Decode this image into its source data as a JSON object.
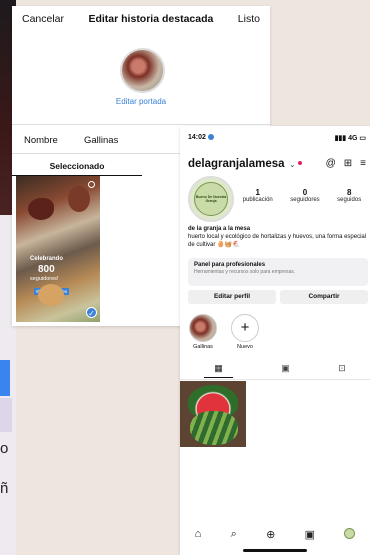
{
  "edit_highlight": {
    "cancel": "Cancelar",
    "title": "Editar historia destacada",
    "done": "Listo",
    "edit_cover": "Editar portada",
    "name_label": "Nombre",
    "name_value": "Gallinas",
    "tab_selected": "Seleccionado",
    "story": {
      "line1": "Celebrando",
      "line2": "800",
      "line3": "seguidores!",
      "tag": "#huevoslocales"
    }
  },
  "profile": {
    "time": "14:02",
    "signal": "4G",
    "username": "delagranjalamesa",
    "avatar_text": "Bueno De Nuestra Granja",
    "stats": [
      {
        "number": "1",
        "label": "publicación"
      },
      {
        "number": "0",
        "label": "seguidores"
      },
      {
        "number": "8",
        "label": "seguidos"
      }
    ],
    "bio_name": "de la granja a la mesa",
    "bio_text": "huerto local y ecológico de hortalizas y huevos, una forma especial de cultivar 🥚🧺🐔",
    "pro_panel_title": "Panel para profesionales",
    "pro_panel_sub": "Herramientas y recursos solo para empresas.",
    "edit_profile": "Editar perfil",
    "share": "Compartir",
    "highlights": [
      {
        "label": "Gallinas"
      },
      {
        "label": "Nuevo"
      }
    ]
  },
  "left_strip": {
    "glyphs": [
      "o",
      "ñ"
    ]
  }
}
